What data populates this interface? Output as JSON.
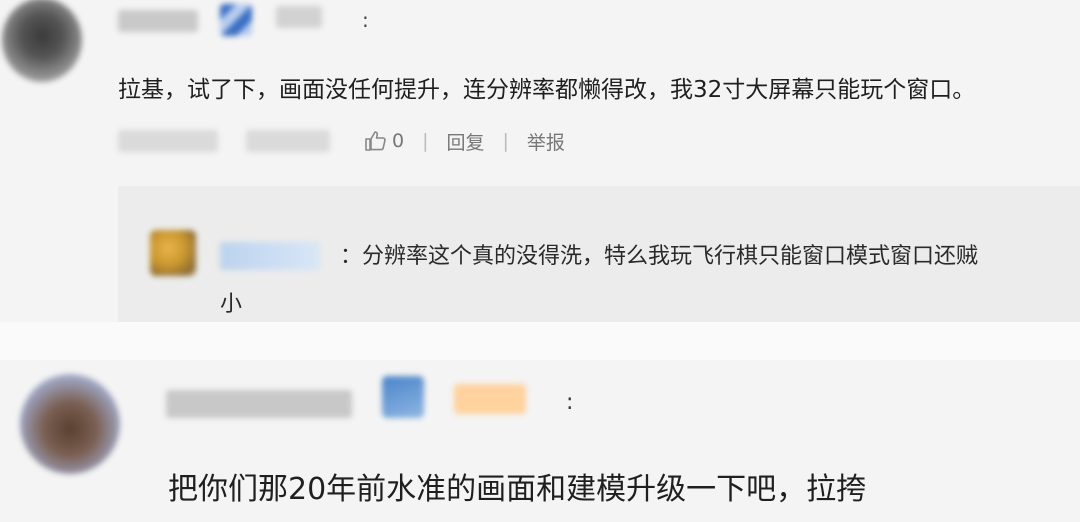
{
  "comment1": {
    "more_label": ":",
    "text": "拉基，试了下，画面没任何提升，连分辨率都懒得改，我32寸大屏幕只能玩个窗口。",
    "like_count": "0",
    "reply_label": "回复",
    "report_label": "举报",
    "reply": {
      "text": "：分辨率这个真的没得洗，特么我玩飞行棋只能窗口模式窗口还贼",
      "text_cont": "小"
    }
  },
  "comment2": {
    "more_label": ":",
    "text": "把你们那20年前水准的画面和建模升级一下吧，拉挎"
  },
  "colors": {
    "background": "#f4f4f4",
    "reply_background": "#ececec",
    "divider": "#fafafa",
    "meta_text": "#777777",
    "badge_blue": "#3b6fc4",
    "tag_orange": "#ffd29e"
  }
}
